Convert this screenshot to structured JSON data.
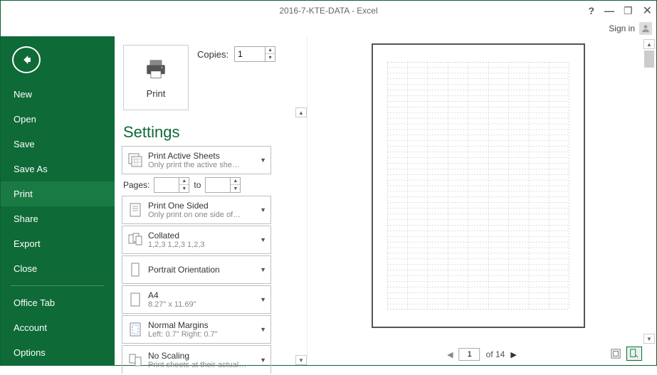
{
  "window": {
    "title": "2016-7-KTE-DATA - Excel",
    "signin": "Sign in"
  },
  "sidebar": {
    "items": [
      {
        "label": "New"
      },
      {
        "label": "Open"
      },
      {
        "label": "Save"
      },
      {
        "label": "Save As"
      },
      {
        "label": "Print",
        "active": true
      },
      {
        "label": "Share"
      },
      {
        "label": "Export"
      },
      {
        "label": "Close"
      }
    ],
    "items2": [
      {
        "label": "Office Tab"
      },
      {
        "label": "Account"
      },
      {
        "label": "Options"
      }
    ]
  },
  "print": {
    "button_label": "Print",
    "copies_label": "Copies:",
    "copies_value": "1",
    "settings_title": "Settings",
    "pages_label": "Pages:",
    "to_label": "to",
    "options": [
      {
        "title": "Print Active Sheets",
        "sub": "Only print the active she…",
        "icon": "sheets"
      },
      {
        "title": "Print One Sided",
        "sub": "Only print on one side of…",
        "icon": "oneside"
      },
      {
        "title": "Collated",
        "sub": "1,2,3    1,2,3    1,2,3",
        "icon": "collated"
      },
      {
        "title": "Portrait Orientation",
        "sub": "",
        "icon": "portrait"
      },
      {
        "title": "A4",
        "sub": "8.27\" x 11.69\"",
        "icon": "a4"
      },
      {
        "title": "Normal Margins",
        "sub": "Left:  0.7\"    Right:  0.7\"",
        "icon": "margins"
      },
      {
        "title": "No Scaling",
        "sub": "Print sheets at their actual…",
        "icon": "scaling"
      }
    ]
  },
  "preview": {
    "current_page": "1",
    "total": "of 14"
  }
}
